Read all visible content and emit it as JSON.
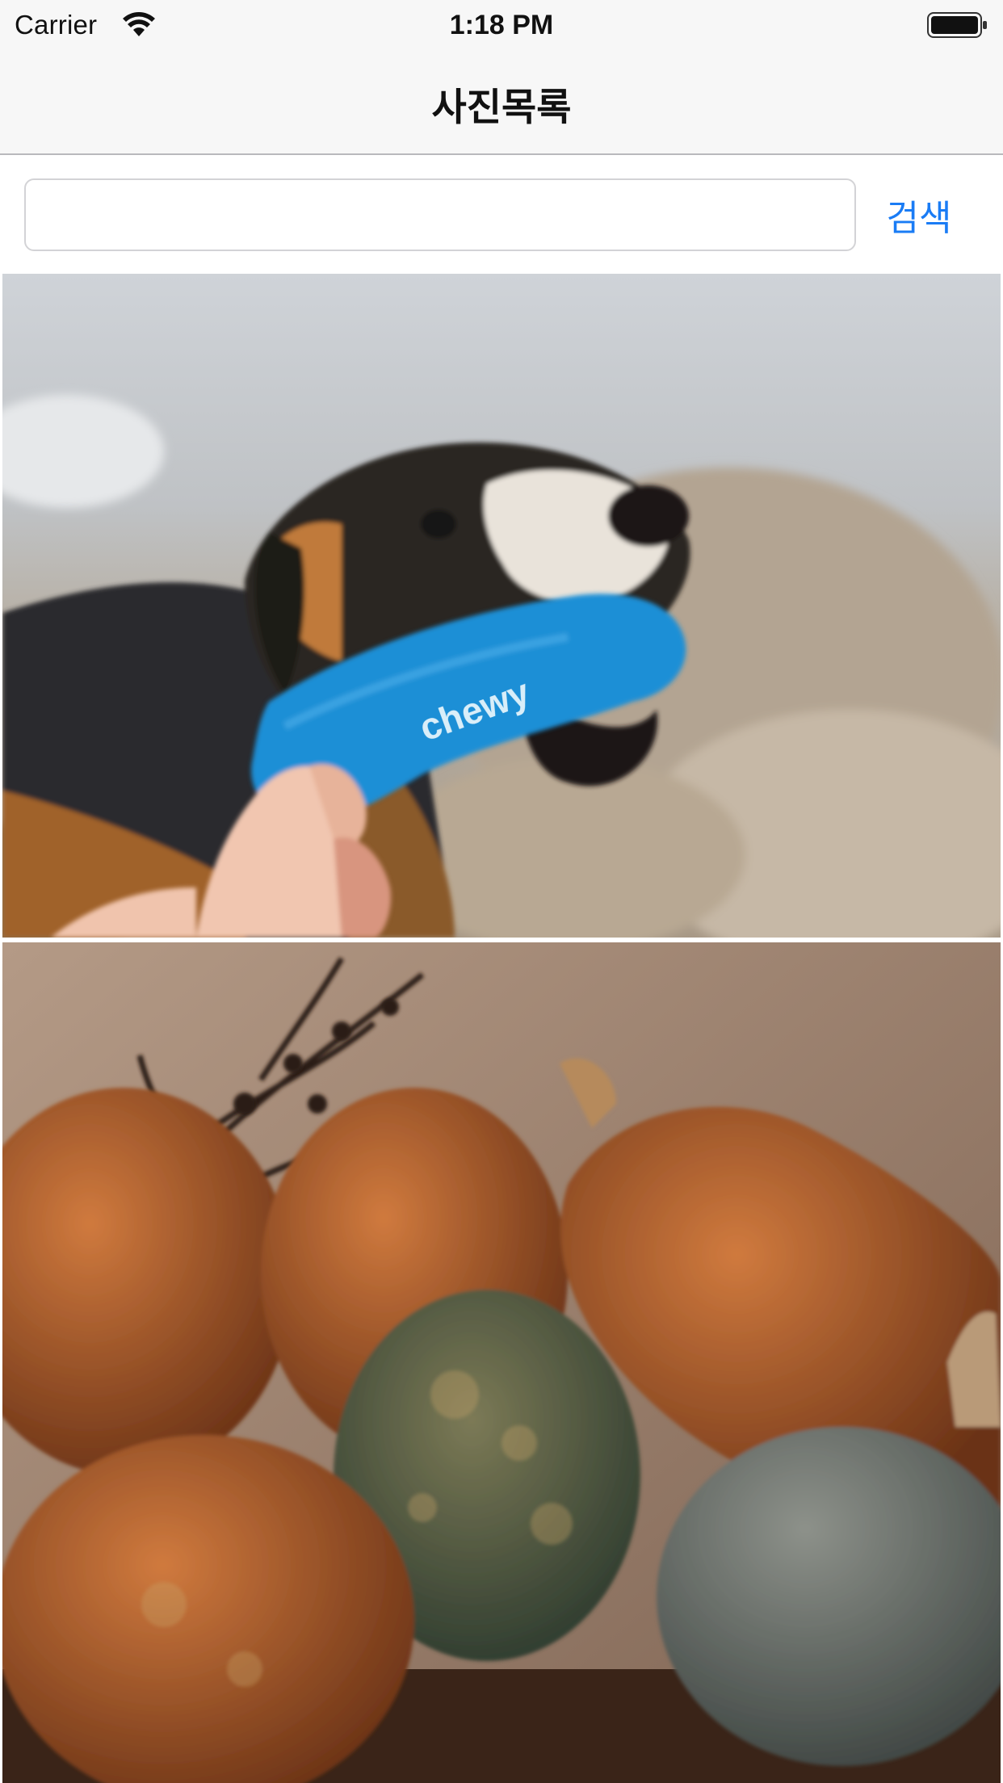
{
  "status_bar": {
    "carrier": "Carrier",
    "time": "1:18 PM",
    "wifi_icon": "wifi-icon",
    "battery_icon": "battery-full-icon"
  },
  "nav": {
    "title": "사진목록"
  },
  "search": {
    "value": "",
    "placeholder": "",
    "button_label": "검색",
    "accent_color": "#1a7cf5"
  },
  "photos": [
    {
      "subject": "dog-with-toy",
      "toy_text": "chewy"
    },
    {
      "subject": "pumpkins"
    }
  ]
}
